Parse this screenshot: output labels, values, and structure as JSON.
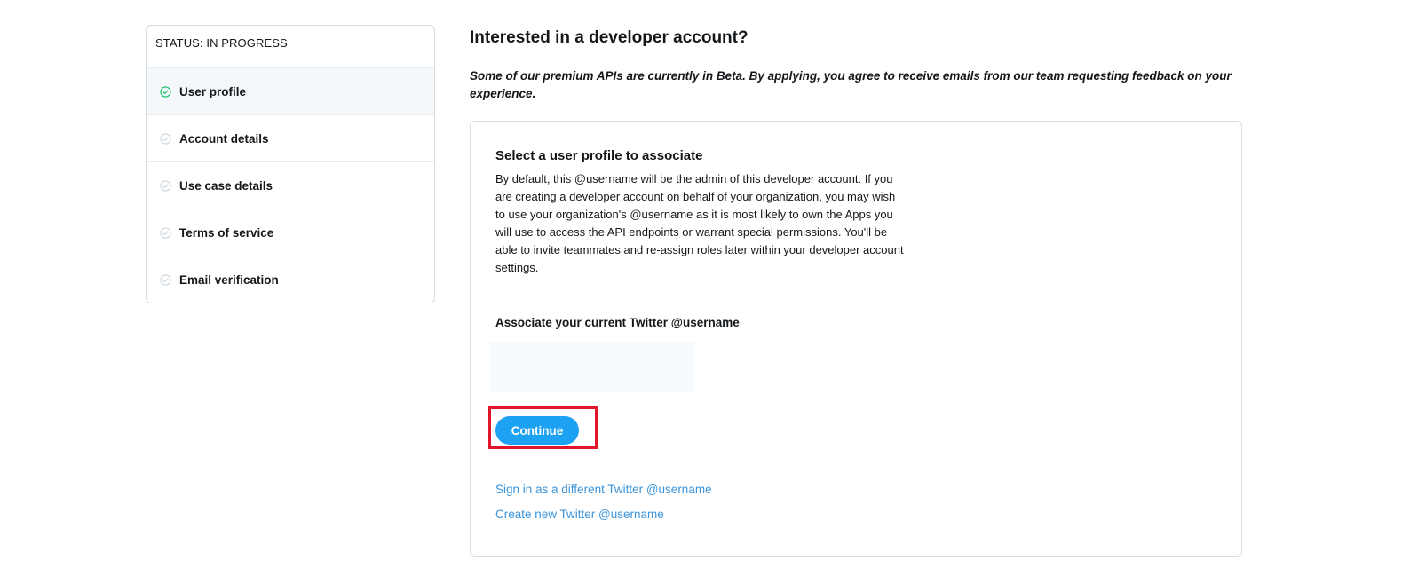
{
  "sidebar": {
    "status": "STATUS: IN PROGRESS",
    "items": [
      {
        "label": "User profile",
        "state": "complete"
      },
      {
        "label": "Account details",
        "state": "pending"
      },
      {
        "label": "Use case details",
        "state": "pending"
      },
      {
        "label": "Terms of service",
        "state": "pending"
      },
      {
        "label": "Email verification",
        "state": "pending"
      }
    ]
  },
  "main": {
    "title": "Interested in a developer account?",
    "beta_note": "Some of our premium APIs are currently in Beta. By applying, you agree to receive emails from our team requesting feedback on your experience.",
    "card": {
      "heading": "Select a user profile to associate",
      "description": "By default, this @username will be the admin of this developer account. If you are creating a developer account on behalf of your organization, you may wish to use your organization's @username as it is most likely to own the Apps you will use to access the API endpoints or warrant special permissions. You'll be able to invite teammates and re-assign roles later within your developer account settings.",
      "associate_label": "Associate your current Twitter @username",
      "continue_label": "Continue",
      "link_sign_in": "Sign in as a different Twitter @username",
      "link_create": "Create new Twitter @username"
    }
  },
  "colors": {
    "accent": "#1da1f2",
    "link": "#3b94d9",
    "highlight": "#e0142b",
    "complete_check": "#17bf63",
    "pending_check": "#ccd6dd"
  },
  "icons": {
    "complete": "check-circle-icon",
    "pending": "check-circle-outline-icon"
  }
}
